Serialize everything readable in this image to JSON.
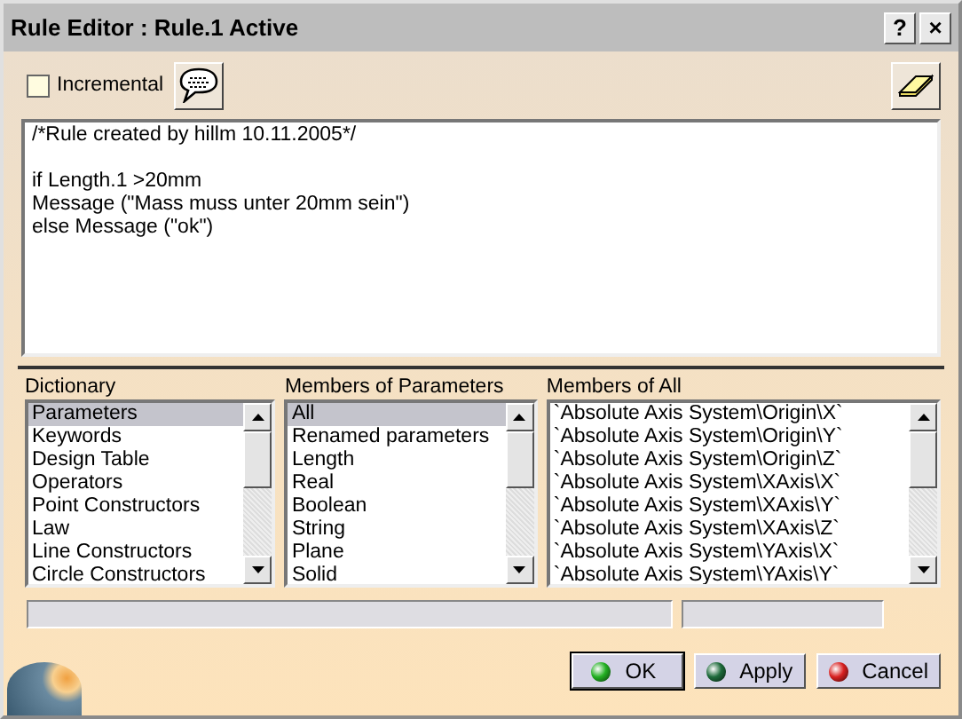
{
  "window": {
    "title": "Rule Editor : Rule.1 Active",
    "buttons": [
      "?",
      "×"
    ]
  },
  "toolbar": {
    "incremental": {
      "label": "Incremental",
      "checked": false
    }
  },
  "editor": {
    "text": "/*Rule created by hillm 10.11.2005*/\n\nif Length.1 >20mm\nMessage (\"Mass muss unter 20mm sein\")\nelse Message (\"ok\")"
  },
  "lists": [
    {
      "label": "Dictionary",
      "items": [
        {
          "label": "Parameters",
          "selected": true
        },
        {
          "label": "Keywords",
          "selected": false
        },
        {
          "label": "Design Table",
          "selected": false
        },
        {
          "label": "Operators",
          "selected": false
        },
        {
          "label": "Point Constructors",
          "selected": false
        },
        {
          "label": "Law",
          "selected": false
        },
        {
          "label": "Line Constructors",
          "selected": false
        },
        {
          "label": "Circle Constructors",
          "selected": false
        }
      ]
    },
    {
      "label": "Members of Parameters",
      "items": [
        {
          "label": "All",
          "selected": true
        },
        {
          "label": "Renamed parameters",
          "selected": false
        },
        {
          "label": "Length",
          "selected": false
        },
        {
          "label": "Real",
          "selected": false
        },
        {
          "label": "Boolean",
          "selected": false
        },
        {
          "label": "String",
          "selected": false
        },
        {
          "label": "Plane",
          "selected": false
        },
        {
          "label": "Solid",
          "selected": false
        }
      ]
    },
    {
      "label": "Members of All",
      "items": [
        {
          "label": "`Absolute Axis System\\Origin\\X`",
          "selected": false
        },
        {
          "label": "`Absolute Axis System\\Origin\\Y`",
          "selected": false
        },
        {
          "label": "`Absolute Axis System\\Origin\\Z`",
          "selected": false
        },
        {
          "label": "`Absolute Axis System\\XAxis\\X`",
          "selected": false
        },
        {
          "label": "`Absolute Axis System\\XAxis\\Y`",
          "selected": false
        },
        {
          "label": "`Absolute Axis System\\XAxis\\Z`",
          "selected": false
        },
        {
          "label": "`Absolute Axis System\\YAxis\\X`",
          "selected": false
        },
        {
          "label": "`Absolute Axis System\\YAxis\\Y`",
          "selected": false
        }
      ]
    }
  ],
  "buttons": [
    {
      "label": "OK",
      "kind": "ok",
      "default": true
    },
    {
      "label": "Apply",
      "kind": "apply",
      "default": false
    },
    {
      "label": "Cancel",
      "kind": "cancel",
      "default": false
    }
  ]
}
